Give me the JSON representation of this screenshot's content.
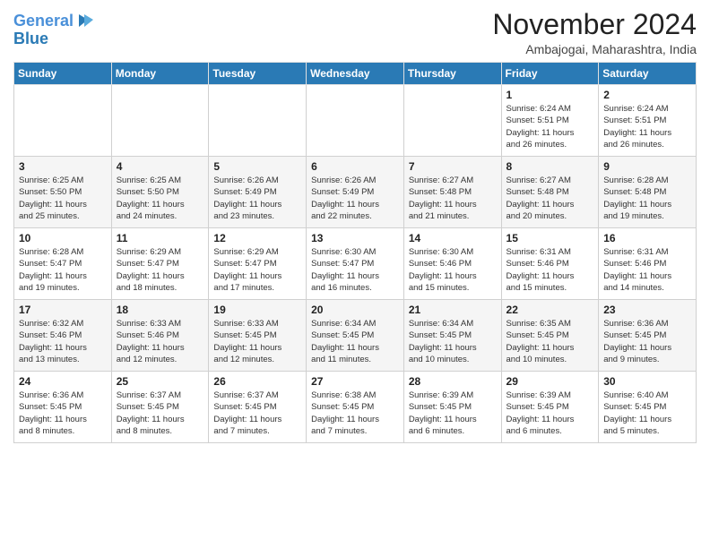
{
  "logo": {
    "line1": "General",
    "line2": "Blue"
  },
  "title": "November 2024",
  "location": "Ambajogai, Maharashtra, India",
  "headers": [
    "Sunday",
    "Monday",
    "Tuesday",
    "Wednesday",
    "Thursday",
    "Friday",
    "Saturday"
  ],
  "weeks": [
    [
      {
        "day": "",
        "info": ""
      },
      {
        "day": "",
        "info": ""
      },
      {
        "day": "",
        "info": ""
      },
      {
        "day": "",
        "info": ""
      },
      {
        "day": "",
        "info": ""
      },
      {
        "day": "1",
        "info": "Sunrise: 6:24 AM\nSunset: 5:51 PM\nDaylight: 11 hours\nand 26 minutes."
      },
      {
        "day": "2",
        "info": "Sunrise: 6:24 AM\nSunset: 5:51 PM\nDaylight: 11 hours\nand 26 minutes."
      }
    ],
    [
      {
        "day": "3",
        "info": "Sunrise: 6:25 AM\nSunset: 5:50 PM\nDaylight: 11 hours\nand 25 minutes."
      },
      {
        "day": "4",
        "info": "Sunrise: 6:25 AM\nSunset: 5:50 PM\nDaylight: 11 hours\nand 24 minutes."
      },
      {
        "day": "5",
        "info": "Sunrise: 6:26 AM\nSunset: 5:49 PM\nDaylight: 11 hours\nand 23 minutes."
      },
      {
        "day": "6",
        "info": "Sunrise: 6:26 AM\nSunset: 5:49 PM\nDaylight: 11 hours\nand 22 minutes."
      },
      {
        "day": "7",
        "info": "Sunrise: 6:27 AM\nSunset: 5:48 PM\nDaylight: 11 hours\nand 21 minutes."
      },
      {
        "day": "8",
        "info": "Sunrise: 6:27 AM\nSunset: 5:48 PM\nDaylight: 11 hours\nand 20 minutes."
      },
      {
        "day": "9",
        "info": "Sunrise: 6:28 AM\nSunset: 5:48 PM\nDaylight: 11 hours\nand 19 minutes."
      }
    ],
    [
      {
        "day": "10",
        "info": "Sunrise: 6:28 AM\nSunset: 5:47 PM\nDaylight: 11 hours\nand 19 minutes."
      },
      {
        "day": "11",
        "info": "Sunrise: 6:29 AM\nSunset: 5:47 PM\nDaylight: 11 hours\nand 18 minutes."
      },
      {
        "day": "12",
        "info": "Sunrise: 6:29 AM\nSunset: 5:47 PM\nDaylight: 11 hours\nand 17 minutes."
      },
      {
        "day": "13",
        "info": "Sunrise: 6:30 AM\nSunset: 5:47 PM\nDaylight: 11 hours\nand 16 minutes."
      },
      {
        "day": "14",
        "info": "Sunrise: 6:30 AM\nSunset: 5:46 PM\nDaylight: 11 hours\nand 15 minutes."
      },
      {
        "day": "15",
        "info": "Sunrise: 6:31 AM\nSunset: 5:46 PM\nDaylight: 11 hours\nand 15 minutes."
      },
      {
        "day": "16",
        "info": "Sunrise: 6:31 AM\nSunset: 5:46 PM\nDaylight: 11 hours\nand 14 minutes."
      }
    ],
    [
      {
        "day": "17",
        "info": "Sunrise: 6:32 AM\nSunset: 5:46 PM\nDaylight: 11 hours\nand 13 minutes."
      },
      {
        "day": "18",
        "info": "Sunrise: 6:33 AM\nSunset: 5:46 PM\nDaylight: 11 hours\nand 12 minutes."
      },
      {
        "day": "19",
        "info": "Sunrise: 6:33 AM\nSunset: 5:45 PM\nDaylight: 11 hours\nand 12 minutes."
      },
      {
        "day": "20",
        "info": "Sunrise: 6:34 AM\nSunset: 5:45 PM\nDaylight: 11 hours\nand 11 minutes."
      },
      {
        "day": "21",
        "info": "Sunrise: 6:34 AM\nSunset: 5:45 PM\nDaylight: 11 hours\nand 10 minutes."
      },
      {
        "day": "22",
        "info": "Sunrise: 6:35 AM\nSunset: 5:45 PM\nDaylight: 11 hours\nand 10 minutes."
      },
      {
        "day": "23",
        "info": "Sunrise: 6:36 AM\nSunset: 5:45 PM\nDaylight: 11 hours\nand 9 minutes."
      }
    ],
    [
      {
        "day": "24",
        "info": "Sunrise: 6:36 AM\nSunset: 5:45 PM\nDaylight: 11 hours\nand 8 minutes."
      },
      {
        "day": "25",
        "info": "Sunrise: 6:37 AM\nSunset: 5:45 PM\nDaylight: 11 hours\nand 8 minutes."
      },
      {
        "day": "26",
        "info": "Sunrise: 6:37 AM\nSunset: 5:45 PM\nDaylight: 11 hours\nand 7 minutes."
      },
      {
        "day": "27",
        "info": "Sunrise: 6:38 AM\nSunset: 5:45 PM\nDaylight: 11 hours\nand 7 minutes."
      },
      {
        "day": "28",
        "info": "Sunrise: 6:39 AM\nSunset: 5:45 PM\nDaylight: 11 hours\nand 6 minutes."
      },
      {
        "day": "29",
        "info": "Sunrise: 6:39 AM\nSunset: 5:45 PM\nDaylight: 11 hours\nand 6 minutes."
      },
      {
        "day": "30",
        "info": "Sunrise: 6:40 AM\nSunset: 5:45 PM\nDaylight: 11 hours\nand 5 minutes."
      }
    ]
  ]
}
